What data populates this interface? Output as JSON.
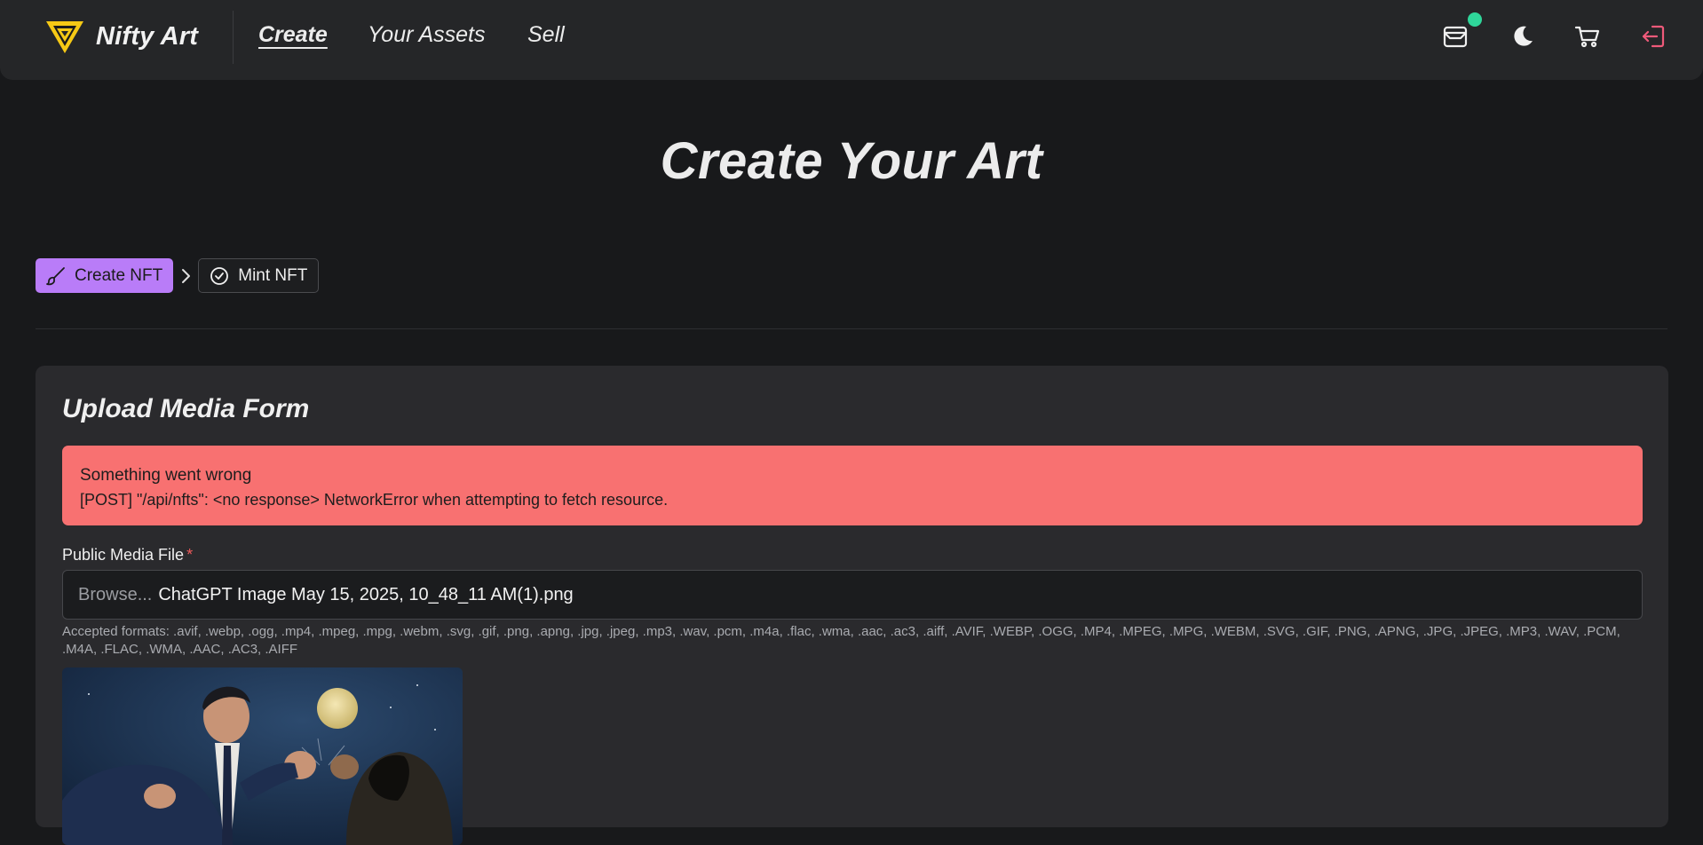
{
  "navbar": {
    "brand": "Nifty Art",
    "links": [
      "Create",
      "Your Assets",
      "Sell"
    ],
    "icons": [
      "wallet-icon",
      "moon-icon",
      "cart-icon",
      "logout-icon"
    ],
    "accent_status": "#2fd69a",
    "logout_color": "#ef5a7a"
  },
  "page": {
    "title": "Create Your Art"
  },
  "stepper": {
    "steps": [
      {
        "label": "Create NFT",
        "icon": "brush-icon",
        "active": true
      },
      {
        "label": "Mint NFT",
        "icon": "check-circle-icon",
        "active": false
      }
    ],
    "accent": "#b97cf8"
  },
  "form": {
    "title": "Upload Media Form",
    "alert": {
      "title": "Something went wrong",
      "message": "[POST] \"/api/nfts\": <no response> NetworkError when attempting to fetch resource.",
      "color": "#f87171"
    },
    "media_field": {
      "label": "Public Media File",
      "required_mark": "*",
      "browse_label": "Browse...",
      "file_name": "ChatGPT Image May 15, 2025, 10_48_11 AM(1).png",
      "accepted_formats": "Accepted formats: .avif, .webp, .ogg, .mp4, .mpeg, .mpg, .webm, .svg, .gif, .png, .apng, .jpg, .jpeg, .mp3, .wav, .pcm, .m4a, .flac, .wma, .aac, .ac3, .aiff, .AVIF, .WEBP, .OGG, .MP4, .MPEG, .MPG, .WEBM, .SVG, .GIF, .PNG, .APNG, .JPG, .JPEG, .MP3, .WAV, .PCM, .M4A, .FLAC, .WMA, .AAC, .AC3, .AIFF"
    }
  }
}
